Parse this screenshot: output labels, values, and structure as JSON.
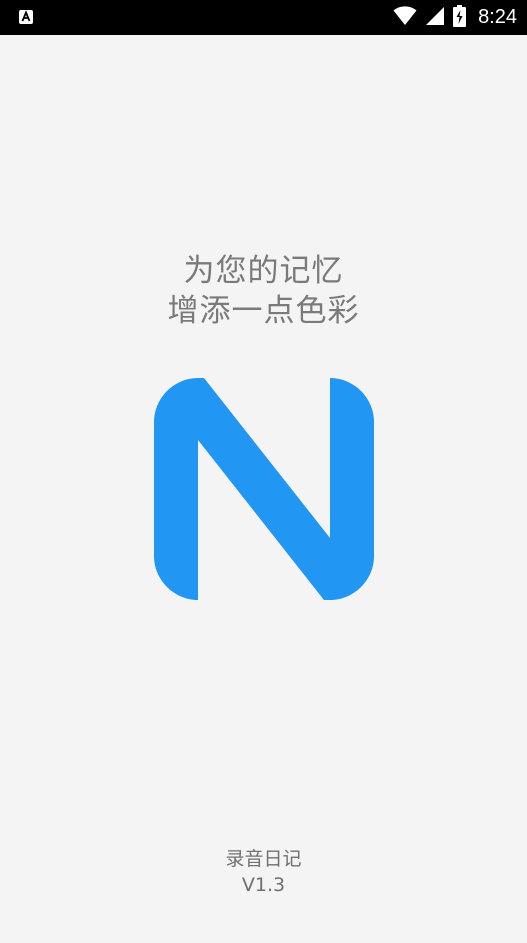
{
  "status_bar": {
    "time": "8:24",
    "left_icon": "a-icon",
    "icons": [
      "wifi-icon",
      "signal-icon",
      "battery-charging-icon"
    ]
  },
  "splash": {
    "tagline_line1": "为您的记忆",
    "tagline_line2": "增添一点色彩",
    "logo_color": "#2196F3",
    "app_name": "录音日记",
    "version": "V1.3"
  },
  "colors": {
    "background": "#f4f4f4",
    "status_bar": "#000000",
    "text": "#7a7a7a",
    "accent": "#2196F3"
  }
}
